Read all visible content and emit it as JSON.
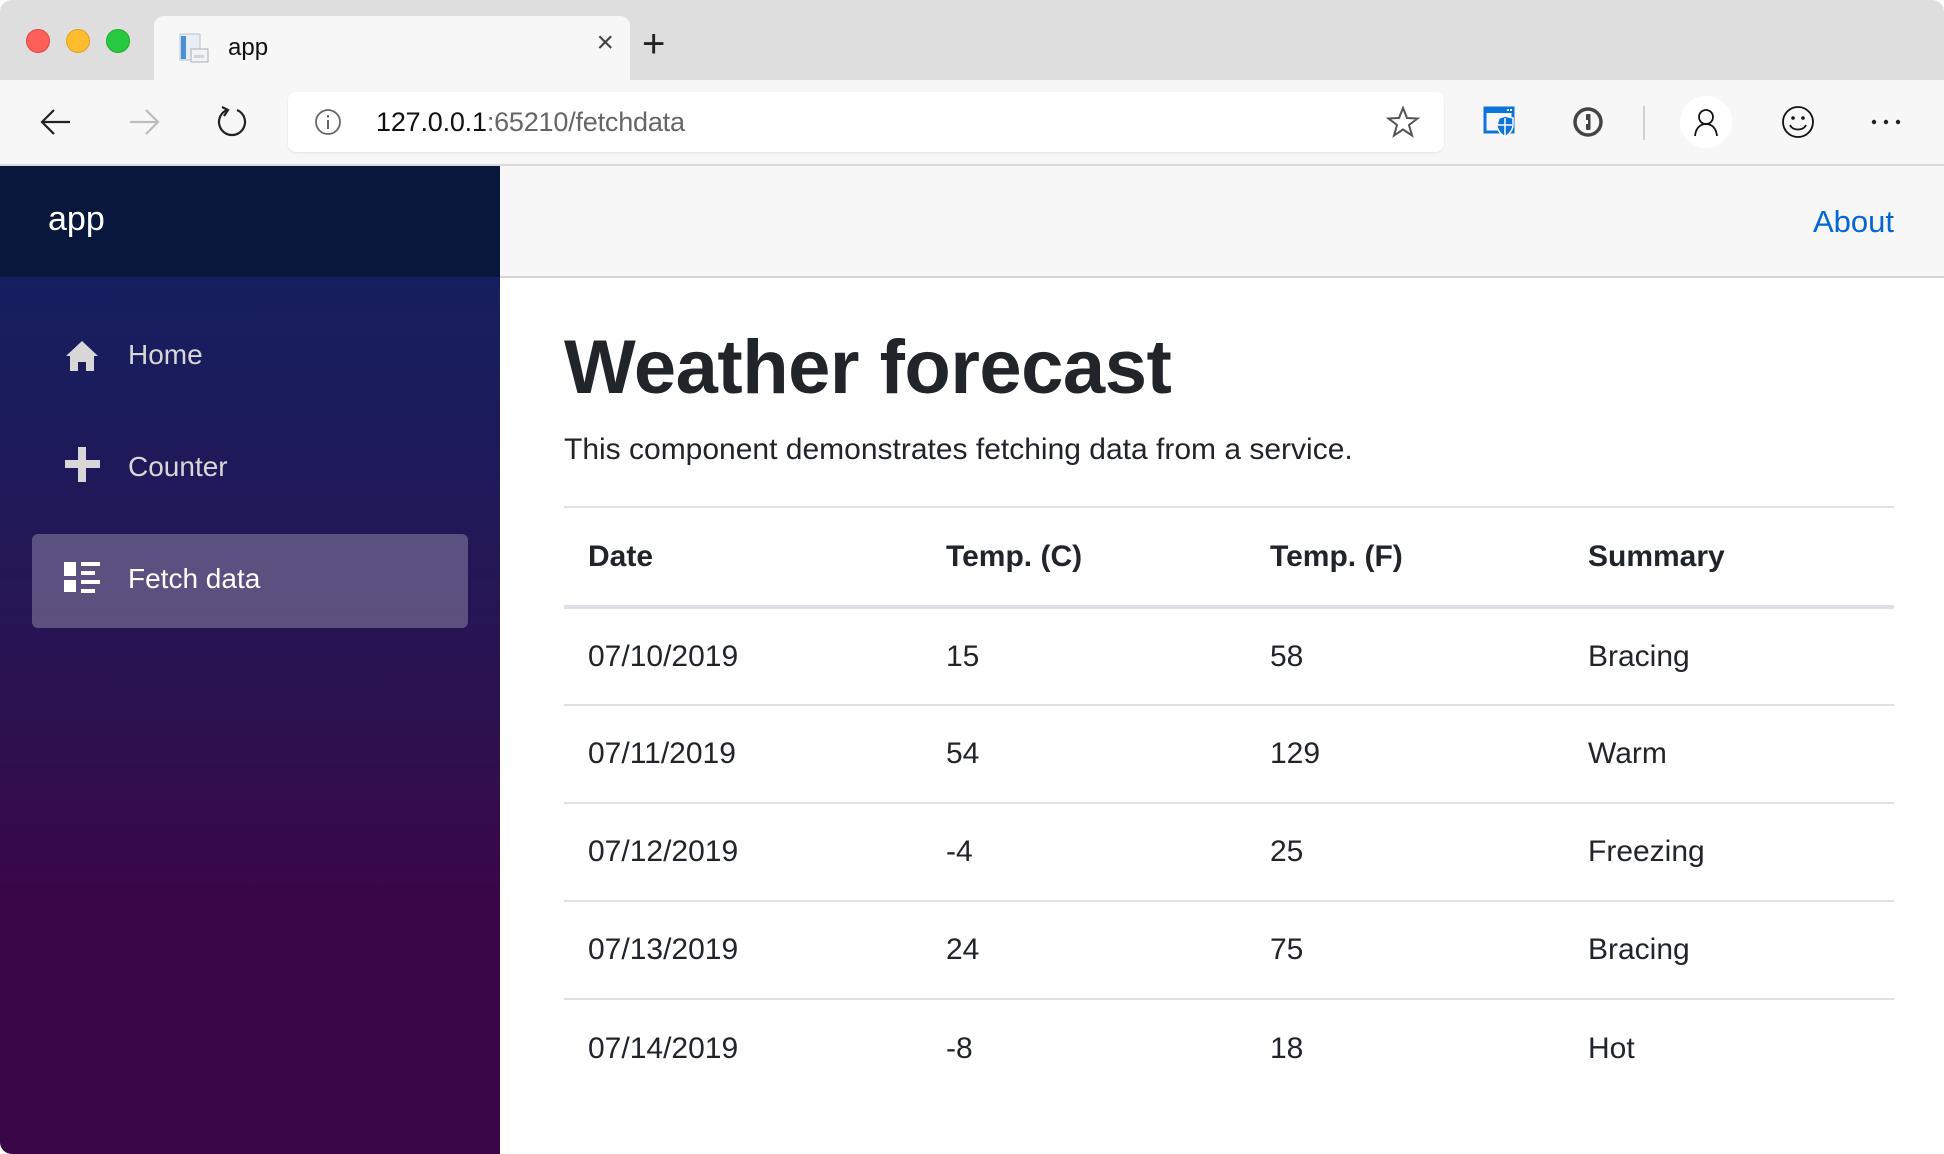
{
  "browser": {
    "tab": {
      "title": "app",
      "favicon": "document-favicon-icon",
      "close_icon": "×"
    },
    "new_tab_icon": "+",
    "address": {
      "host": "127.0.0.1",
      "rest": ":65210/fetchdata"
    },
    "icons": [
      "back-arrow-icon",
      "forward-arrow-icon",
      "refresh-icon",
      "info-icon",
      "star-icon",
      "defender-shield-icon",
      "password-manager-icon",
      "profile-icon",
      "smiley-feedback-icon",
      "more-icon"
    ],
    "more_glyph": "···"
  },
  "sidebar": {
    "brand": "app",
    "items": [
      {
        "label": "Home",
        "icon": "home-icon",
        "active": false
      },
      {
        "label": "Counter",
        "icon": "plus-icon",
        "active": false
      },
      {
        "label": "Fetch data",
        "icon": "list-icon",
        "active": true
      }
    ]
  },
  "top_row": {
    "about_link": "About"
  },
  "main": {
    "title": "Weather forecast",
    "description": "This component demonstrates fetching data from a service.",
    "table": {
      "headers": [
        "Date",
        "Temp. (C)",
        "Temp. (F)",
        "Summary"
      ],
      "rows": [
        [
          "07/10/2019",
          "15",
          "58",
          "Bracing"
        ],
        [
          "07/11/2019",
          "54",
          "129",
          "Warm"
        ],
        [
          "07/12/2019",
          "-4",
          "25",
          "Freezing"
        ],
        [
          "07/13/2019",
          "24",
          "75",
          "Bracing"
        ],
        [
          "07/14/2019",
          "-8",
          "18",
          "Hot"
        ]
      ]
    }
  },
  "colors": {
    "link": "#0366d6",
    "sidebar_top": "#112262",
    "sidebar_bottom": "#3a0647",
    "brand_bar": "#0a173d",
    "defender_blue": "#0a74da"
  }
}
